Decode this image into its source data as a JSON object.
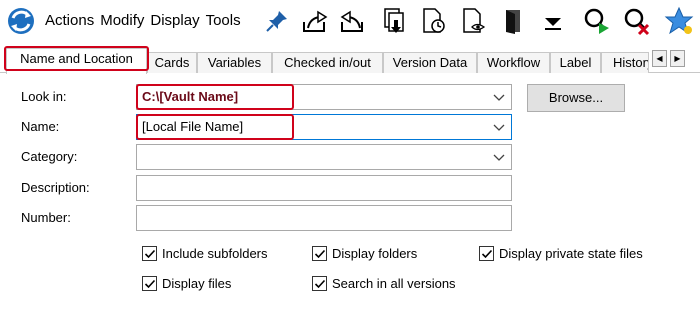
{
  "menu": [
    "Actions",
    "Modify",
    "Display",
    "Tools"
  ],
  "toolbar_icons": [
    "pin-icon",
    "check-in-icon",
    "check-out-icon",
    "get-latest-icon",
    "file-history-icon",
    "view-file-icon",
    "open-folder-icon",
    "dropdown-arrow-icon",
    "find-go-icon",
    "clear-search-icon",
    "favorites-star-icon"
  ],
  "tabs": [
    "Name and Location",
    "Cards",
    "Variables",
    "Checked in/out",
    "Version Data",
    "Workflow",
    "Label",
    "History"
  ],
  "form": {
    "look_in": {
      "label": "Look in:",
      "value": "C:\\[Vault Name]"
    },
    "name": {
      "label": "Name:",
      "value": "[Local File Name]"
    },
    "category": {
      "label": "Category:",
      "value": ""
    },
    "description": {
      "label": "Description:",
      "value": ""
    },
    "number": {
      "label": "Number:",
      "value": ""
    }
  },
  "browse_label": "Browse...",
  "checkboxes": [
    {
      "label": "Include subfolders",
      "checked": true
    },
    {
      "label": "Display folders",
      "checked": true
    },
    {
      "label": "Display private state files",
      "checked": true
    },
    {
      "label": "Display files",
      "checked": true
    },
    {
      "label": "Search in all versions",
      "checked": true
    }
  ],
  "colors": {
    "highlight": "#d0021b",
    "accent": "#0078d7",
    "look_in_text": "#6b0a18"
  }
}
